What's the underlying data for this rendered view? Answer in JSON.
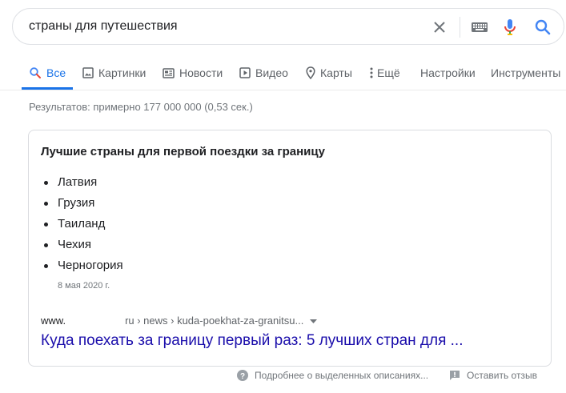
{
  "search": {
    "query": "страны для путешествия"
  },
  "tabs": [
    {
      "label": "Все",
      "icon": "search-icon",
      "active": true
    },
    {
      "label": "Картинки",
      "icon": "image-icon"
    },
    {
      "label": "Новости",
      "icon": "news-icon"
    },
    {
      "label": "Видео",
      "icon": "video-icon"
    },
    {
      "label": "Карты",
      "icon": "map-pin-icon"
    },
    {
      "label": "Ещё",
      "icon": "more-vert-icon"
    },
    {
      "label": "Настройки"
    },
    {
      "label": "Инструменты"
    }
  ],
  "result_stats": "Результатов: примерно 177 000 000 (0,53 сек.)",
  "snippet": {
    "title": "Лучшие страны для первой поездки за границу",
    "items": [
      "Латвия",
      "Грузия",
      "Таиланд",
      "Чехия",
      "Черногория"
    ],
    "date": "8 мая 2020 г.",
    "url_prefix": "www.",
    "url_suffix": "ru › news › kuda-poekhat-za-granitsu...",
    "link": "Куда поехать за границу первый раз: 5 лучших стран для ..."
  },
  "footer": {
    "about": "Подробнее о выделенных описаниях...",
    "feedback": "Оставить отзыв"
  },
  "colors": {
    "accent": "#1a73e8",
    "link": "#1a0dab",
    "mic_blue": "#4285f4",
    "mic_red": "#ea4335"
  }
}
